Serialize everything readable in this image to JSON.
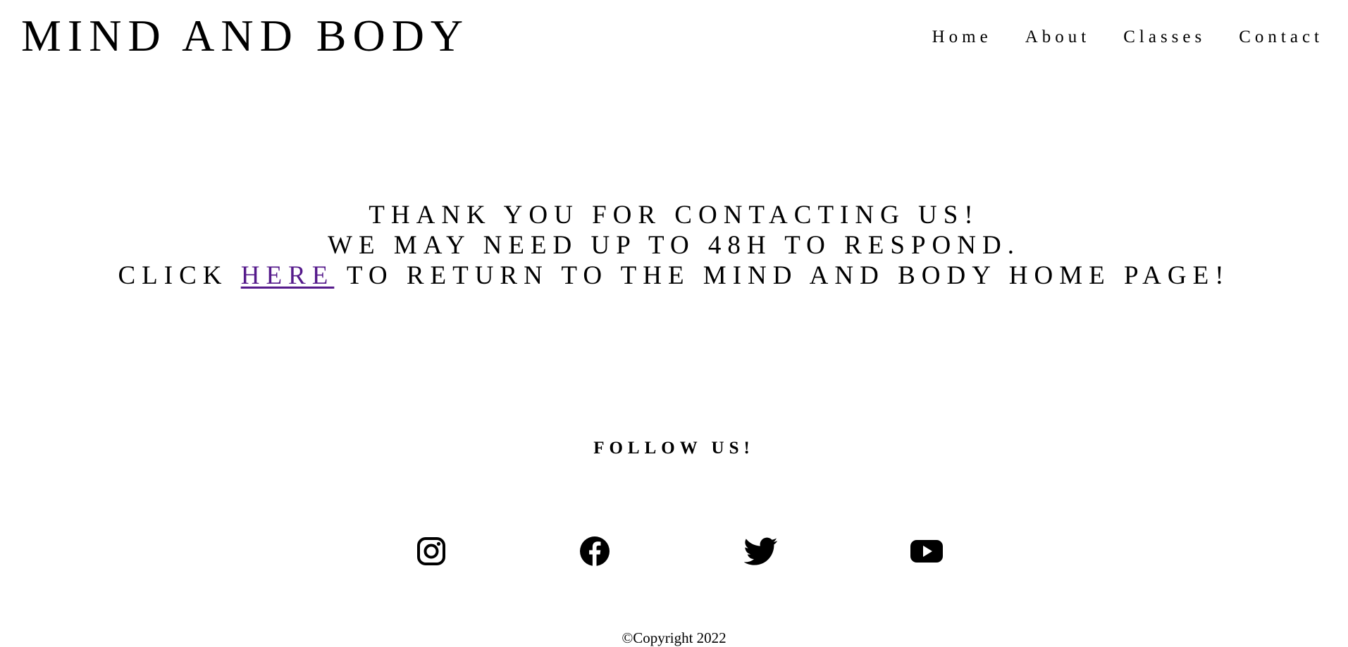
{
  "header": {
    "logo": "MIND AND BODY",
    "nav": [
      {
        "label": "Home"
      },
      {
        "label": "About"
      },
      {
        "label": "Classes"
      },
      {
        "label": "Contact"
      }
    ]
  },
  "message": {
    "line1": "THANK YOU FOR CONTACTING US!",
    "line2": "WE MAY NEED UP TO 48H TO RESPOND.",
    "line3_prefix": "CLICK ",
    "line3_link": "HERE",
    "line3_suffix": " TO RETURN TO THE MIND AND BODY HOME PAGE!"
  },
  "footer": {
    "follow_label": "FOLLOW US!",
    "social": [
      {
        "icon": "instagram-icon"
      },
      {
        "icon": "facebook-icon"
      },
      {
        "icon": "twitter-icon"
      },
      {
        "icon": "youtube-icon"
      }
    ],
    "copyright": "©Copyright 2022"
  },
  "colors": {
    "text": "#000000",
    "background": "#ffffff",
    "visited_link": "#551a8b"
  }
}
